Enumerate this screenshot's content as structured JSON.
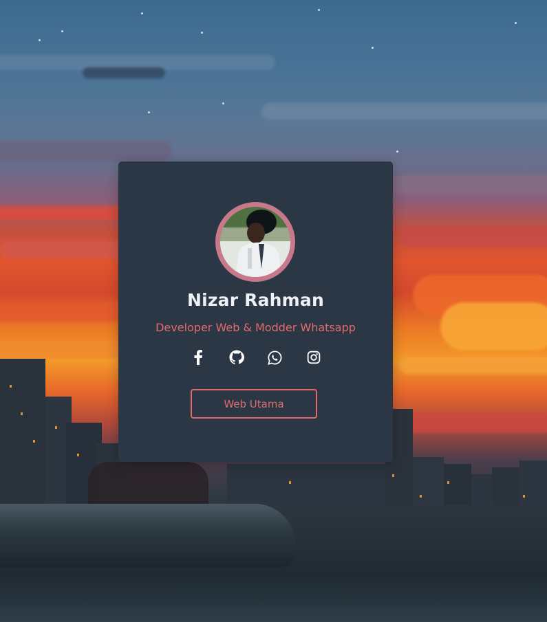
{
  "profile": {
    "name": "Nizar Rahman",
    "role": "Developer Web & Modder Whatsapp",
    "avatar_alt": "profile photo"
  },
  "socials": [
    {
      "icon": "facebook-icon"
    },
    {
      "icon": "github-icon"
    },
    {
      "icon": "whatsapp-icon"
    },
    {
      "icon": "instagram-icon"
    }
  ],
  "button": {
    "label": "Web Utama"
  },
  "colors": {
    "card": "#2c3745",
    "accent": "#e26b6b",
    "avatar_ring": "#c7798c",
    "name_text": "#eef1f5",
    "icon": "#ffffff"
  }
}
